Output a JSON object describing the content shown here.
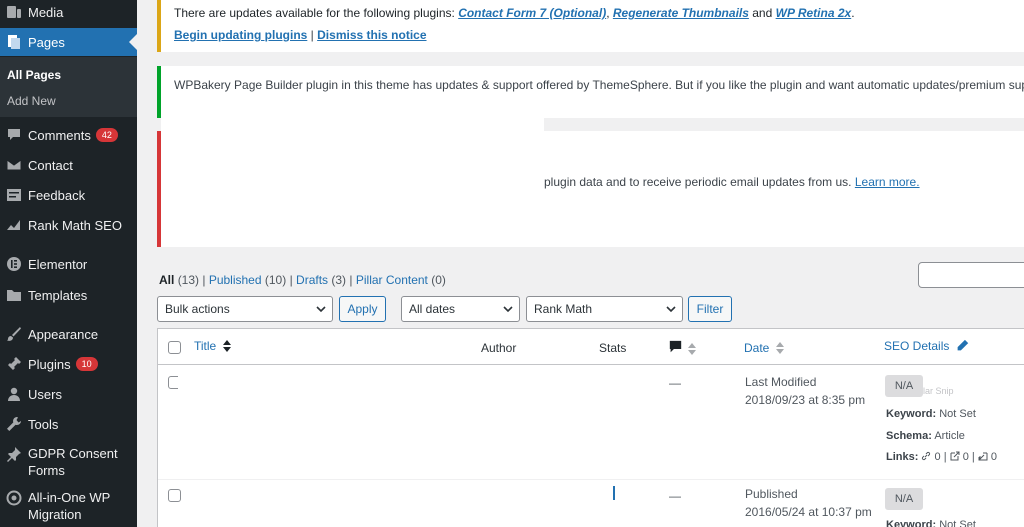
{
  "sidebar": {
    "items": [
      {
        "label": "Media",
        "icon": "media-icon"
      },
      {
        "label": "Pages",
        "icon": "pages-icon"
      },
      {
        "label": "Comments",
        "icon": "comments-icon",
        "badge": "42"
      },
      {
        "label": "Contact",
        "icon": "envelope-icon"
      },
      {
        "label": "Feedback",
        "icon": "feedback-icon"
      },
      {
        "label": "Rank Math SEO",
        "icon": "rank-math-icon"
      },
      {
        "label": "Elementor",
        "icon": "elementor-icon"
      },
      {
        "label": "Templates",
        "icon": "folder-icon"
      },
      {
        "label": "Appearance",
        "icon": "brush-icon"
      },
      {
        "label": "Plugins",
        "icon": "plugin-icon",
        "badge": "10"
      },
      {
        "label": "Users",
        "icon": "users-icon"
      },
      {
        "label": "Tools",
        "icon": "wrench-icon"
      },
      {
        "label": "GDPR Consent Forms",
        "icon": "pin-icon"
      },
      {
        "label": "All-in-One WP Migration",
        "icon": "migration-icon"
      }
    ],
    "submenu": [
      "All Pages",
      "Add New"
    ]
  },
  "notices": {
    "updates": {
      "text": "There are updates available for the following plugins:",
      "links": [
        "Contact Form 7 (Optional)",
        "Regenerate Thumbnails",
        "WP Retina 2x"
      ],
      "and": "and",
      "begin": "Begin updating plugins",
      "sep": "|",
      "dismiss": "Dismiss this notice"
    },
    "wpbakery": "WPBakery Page Builder plugin in this theme has updates & support offered by ThemeSphere. But if you like the plugin and want automatic updates/premium support fro",
    "tracking": {
      "text": "plugin data and to receive periodic email updates from us.",
      "link": "Learn more."
    }
  },
  "views": {
    "all": "All",
    "all_count": "(13)",
    "published": "Published",
    "published_count": "(10)",
    "drafts": "Drafts",
    "drafts_count": "(3)",
    "pillar": "Pillar Content",
    "pillar_count": "(0)"
  },
  "filters": {
    "bulk": "Bulk actions",
    "apply": "Apply",
    "dates": "All dates",
    "rank": "Rank Math",
    "filter": "Filter"
  },
  "table": {
    "headers": {
      "title": "Title",
      "author": "Author",
      "stats": "Stats",
      "date": "Date",
      "seo": "SEO Details"
    },
    "rows": [
      {
        "comments": "—",
        "date_status": "Last Modified",
        "date": "2018/09/23 at 8:35 pm",
        "seo_score": "N/A",
        "faded": "Singular Snip",
        "keyword_label": "Keyword:",
        "keyword": "Not Set",
        "schema_label": "Schema:",
        "schema": "Article",
        "links_label": "Links:",
        "links": [
          "0",
          "0",
          "0"
        ]
      },
      {
        "comments": "—",
        "date_status": "Published",
        "date": "2016/05/24 at 10:37 pm",
        "seo_score": "N/A",
        "keyword_label": "Keyword:",
        "keyword": "Not Set"
      }
    ]
  },
  "colors": {
    "sidebar": "#1d2327",
    "accent": "#2271b1",
    "badge": "#d63638"
  }
}
